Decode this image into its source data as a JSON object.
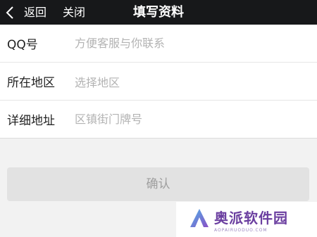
{
  "navbar": {
    "back_label": "返回",
    "close_label": "关闭",
    "title": "填写资料",
    "back_icon": "chevron-left-icon"
  },
  "form": {
    "qq": {
      "label": "QQ号",
      "placeholder": "方便客服与你联系"
    },
    "region": {
      "label": "所在地区",
      "placeholder": "选择地区"
    },
    "address": {
      "label": "详细地址",
      "placeholder": "区镇街门牌号"
    }
  },
  "confirm_label": "确认",
  "watermark": {
    "text": "奥派软件园",
    "sub": "AOPAIRUODUO.COM",
    "logo_icon": "aopai-logo-icon"
  },
  "colors": {
    "navbar_bg": "#17181a",
    "page_bg": "#f2f2f2",
    "button_bg": "#e2e2e2",
    "placeholder": "#b3b3b3",
    "watermark": "#6b3fa0"
  }
}
